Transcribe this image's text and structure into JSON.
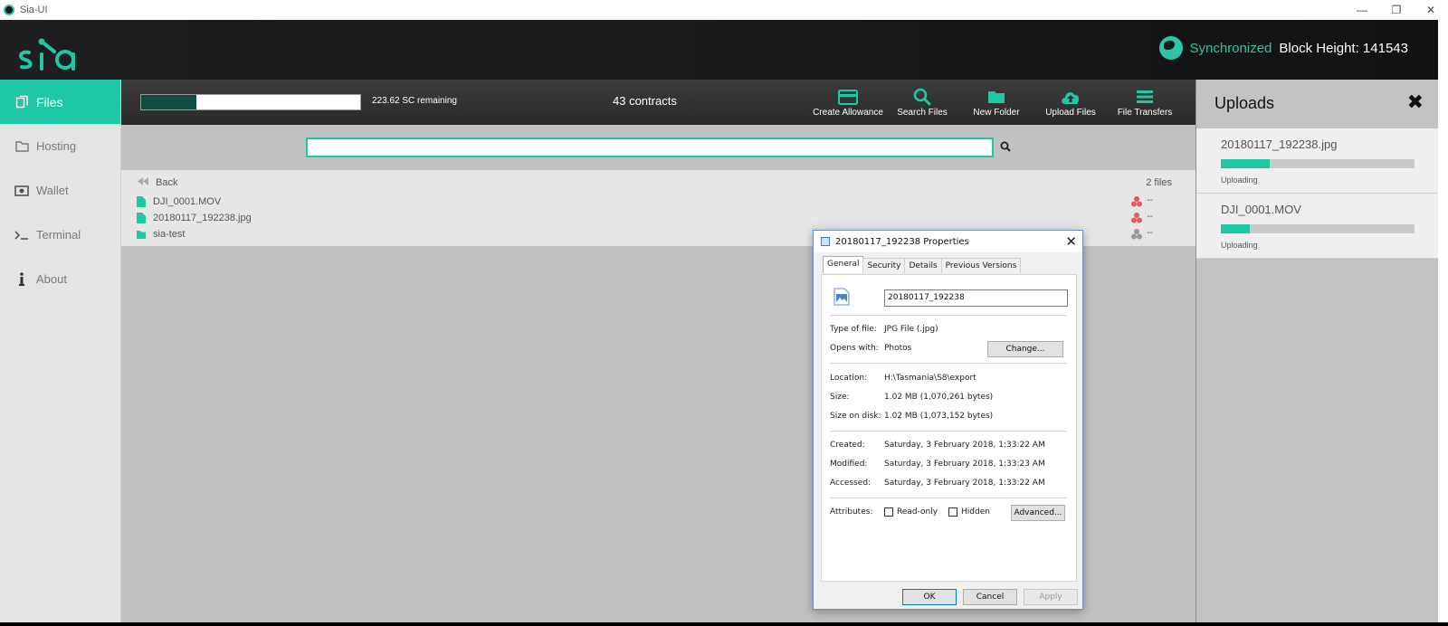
{
  "window": {
    "title": "Sia-UI",
    "controls": {
      "minimize": "—",
      "restore": "❐",
      "close": "✕"
    }
  },
  "header": {
    "sync_status": "Synchronized",
    "block_height": "Block Height: 141543",
    "accent_color": "#1ec8a5"
  },
  "sidebar": {
    "items": [
      {
        "label": "Files",
        "icon": "files-icon",
        "active": true
      },
      {
        "label": "Hosting",
        "icon": "folder-icon",
        "active": false
      },
      {
        "label": "Wallet",
        "icon": "wallet-icon",
        "active": false
      },
      {
        "label": "Terminal",
        "icon": "terminal-icon",
        "active": false
      },
      {
        "label": "About",
        "icon": "info-icon",
        "active": false
      }
    ]
  },
  "toolbar": {
    "allowance_progress": 0.25,
    "remaining": "223.62 SC remaining",
    "contracts": "43 contracts",
    "buttons": [
      {
        "label": "Create Allowance",
        "icon": "credit-card-icon"
      },
      {
        "label": "Search Files",
        "icon": "search-icon"
      },
      {
        "label": "New Folder",
        "icon": "folder-icon"
      },
      {
        "label": "Upload Files",
        "icon": "cloud-upload-icon"
      },
      {
        "label": "File Transfers",
        "icon": "list-icon"
      }
    ]
  },
  "search": {
    "value": "",
    "placeholder": ""
  },
  "files": {
    "back_label": "Back",
    "count": "2 files",
    "items": [
      {
        "name": "DJI_0001.MOV",
        "type": "file",
        "status": "red",
        "extra": "--"
      },
      {
        "name": "20180117_192238.jpg",
        "type": "file",
        "status": "red",
        "extra": "--"
      },
      {
        "name": "sia-test",
        "type": "folder",
        "status": "gray",
        "extra": "--"
      }
    ]
  },
  "uploads": {
    "title": "Uploads",
    "close": "✖",
    "items": [
      {
        "name": "20180117_192238.jpg",
        "progress": 0.25,
        "status": "Uploading"
      },
      {
        "name": "DJI_0001.MOV",
        "progress": 0.15,
        "status": "Uploading"
      }
    ]
  },
  "dialog": {
    "title": "20180117_192238 Properties",
    "close": "✕",
    "tabs": [
      "General",
      "Security",
      "Details",
      "Previous Versions"
    ],
    "name": "20180117_192238",
    "type_label": "Type of file:",
    "type_value": "JPG File (.jpg)",
    "opens_label": "Opens with:",
    "opens_value": "Photos",
    "change_button": "Change...",
    "location_label": "Location:",
    "location_value": "H:\\Tasmania\\S8\\export",
    "size_label": "Size:",
    "size_value": "1.02 MB (1,070,261 bytes)",
    "size_disk_label": "Size on disk:",
    "size_disk_value": "1.02 MB (1,073,152 bytes)",
    "created_label": "Created:",
    "created_value": "Saturday, 3 February 2018, 1:33:22 AM",
    "modified_label": "Modified:",
    "modified_value": "Saturday, 3 February 2018, 1:33:23 AM",
    "accessed_label": "Accessed:",
    "accessed_value": "Saturday, 3 February 2018, 1:33:22 AM",
    "attributes_label": "Attributes:",
    "readonly_label": "Read-only",
    "hidden_label": "Hidden",
    "advanced_button": "Advanced...",
    "ok_button": "OK",
    "cancel_button": "Cancel",
    "apply_button": "Apply"
  }
}
